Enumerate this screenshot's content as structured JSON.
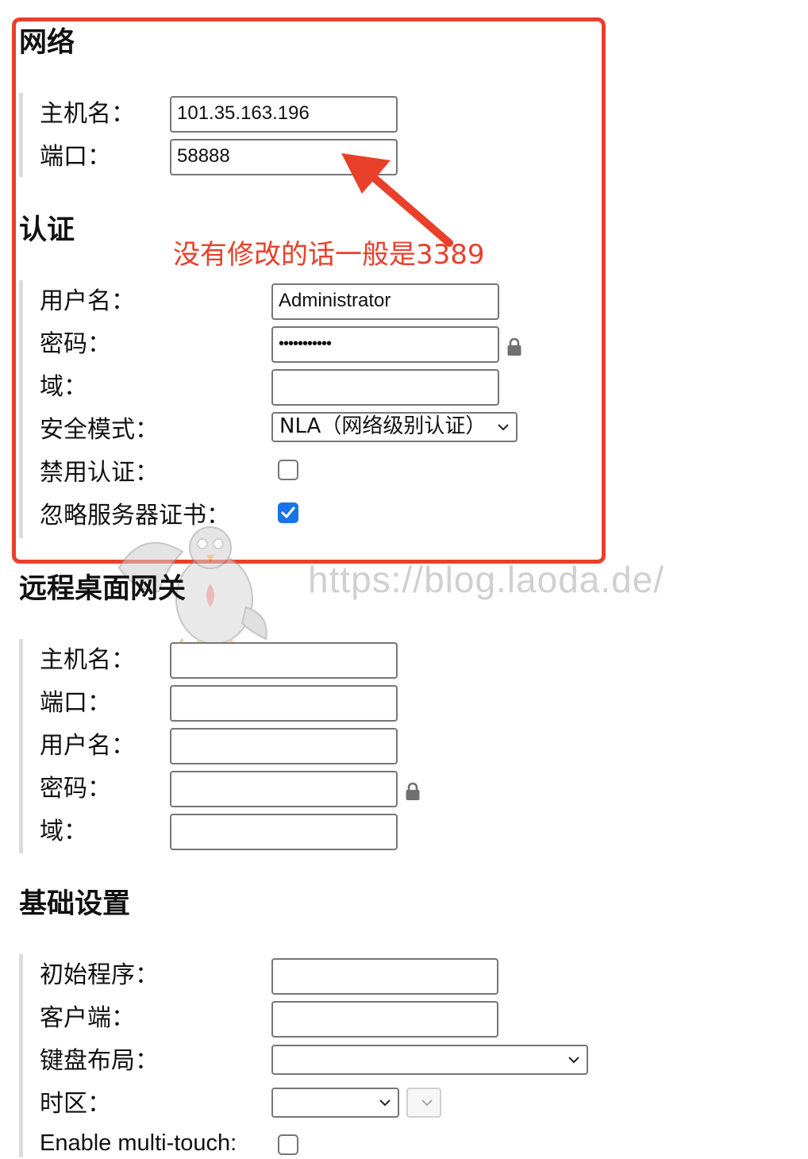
{
  "network": {
    "heading": "网络",
    "hostname_label": "主机名：",
    "hostname_value": "101.35.163.196",
    "port_label": "端口：",
    "port_value": "58888"
  },
  "annotation": {
    "text": "没有修改的话一般是3389",
    "color": "#e8402a"
  },
  "auth": {
    "heading": "认证",
    "username_label": "用户名：",
    "username_value": "Administrator",
    "password_label": "密码：",
    "password_value": "•••••••••••",
    "domain_label": "域：",
    "domain_value": "",
    "security_mode_label": "安全模式：",
    "security_mode_value": "NLA（网络级别认证）",
    "disable_auth_label": "禁用认证：",
    "disable_auth_checked": false,
    "ignore_cert_label": "忽略服务器证书：",
    "ignore_cert_checked": true
  },
  "gateway": {
    "heading": "远程桌面网关",
    "hostname_label": "主机名：",
    "port_label": "端口：",
    "username_label": "用户名：",
    "password_label": "密码：",
    "domain_label": "域："
  },
  "basic": {
    "heading": "基础设置",
    "initial_program_label": "初始程序：",
    "client_label": "客户端：",
    "keyboard_layout_label": "键盘布局：",
    "timezone_label": "时区：",
    "multitouch_label": "Enable multi-touch:",
    "multitouch_checked": false
  },
  "watermark": {
    "text": "https://blog.laoda.de/"
  },
  "icons": {
    "lock": "lock-icon",
    "dropdown": "chevron-down-icon",
    "check": "checkmark-icon",
    "arrow": "red-arrow-icon",
    "mascot": "pigeon-mascot-icon"
  },
  "colors": {
    "highlight_border": "#e8402a",
    "checkbox_checked": "#1a73e8"
  }
}
